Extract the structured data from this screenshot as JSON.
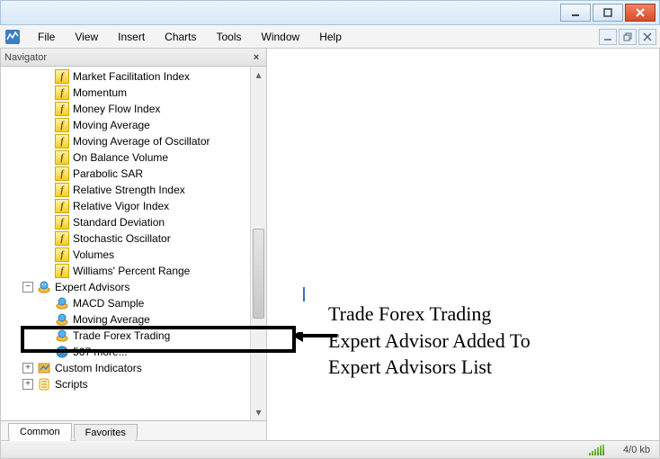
{
  "menus": {
    "file": "File",
    "view": "View",
    "insert": "Insert",
    "charts": "Charts",
    "tools": "Tools",
    "window": "Window",
    "help": "Help"
  },
  "navigator": {
    "title": "Navigator",
    "tabs": {
      "common": "Common",
      "favorites": "Favorites"
    },
    "indicators": [
      "Market Facilitation Index",
      "Momentum",
      "Money Flow Index",
      "Moving Average",
      "Moving Average of Oscillator",
      "On Balance Volume",
      "Parabolic SAR",
      "Relative Strength Index",
      "Relative Vigor Index",
      "Standard Deviation",
      "Stochastic Oscillator",
      "Volumes",
      "Williams' Percent Range"
    ],
    "expert_advisors_label": "Expert Advisors",
    "expert_advisors": [
      "MACD Sample",
      "Moving Average",
      "Trade Forex Trading",
      "567 more..."
    ],
    "custom_indicators_label": "Custom Indicators",
    "scripts_label": "Scripts"
  },
  "annotation": {
    "line1": "Trade Forex Trading",
    "line2": "Expert Advisor Added To",
    "line3": "Expert Advisors List"
  },
  "status": {
    "text": "4/0 kb"
  }
}
